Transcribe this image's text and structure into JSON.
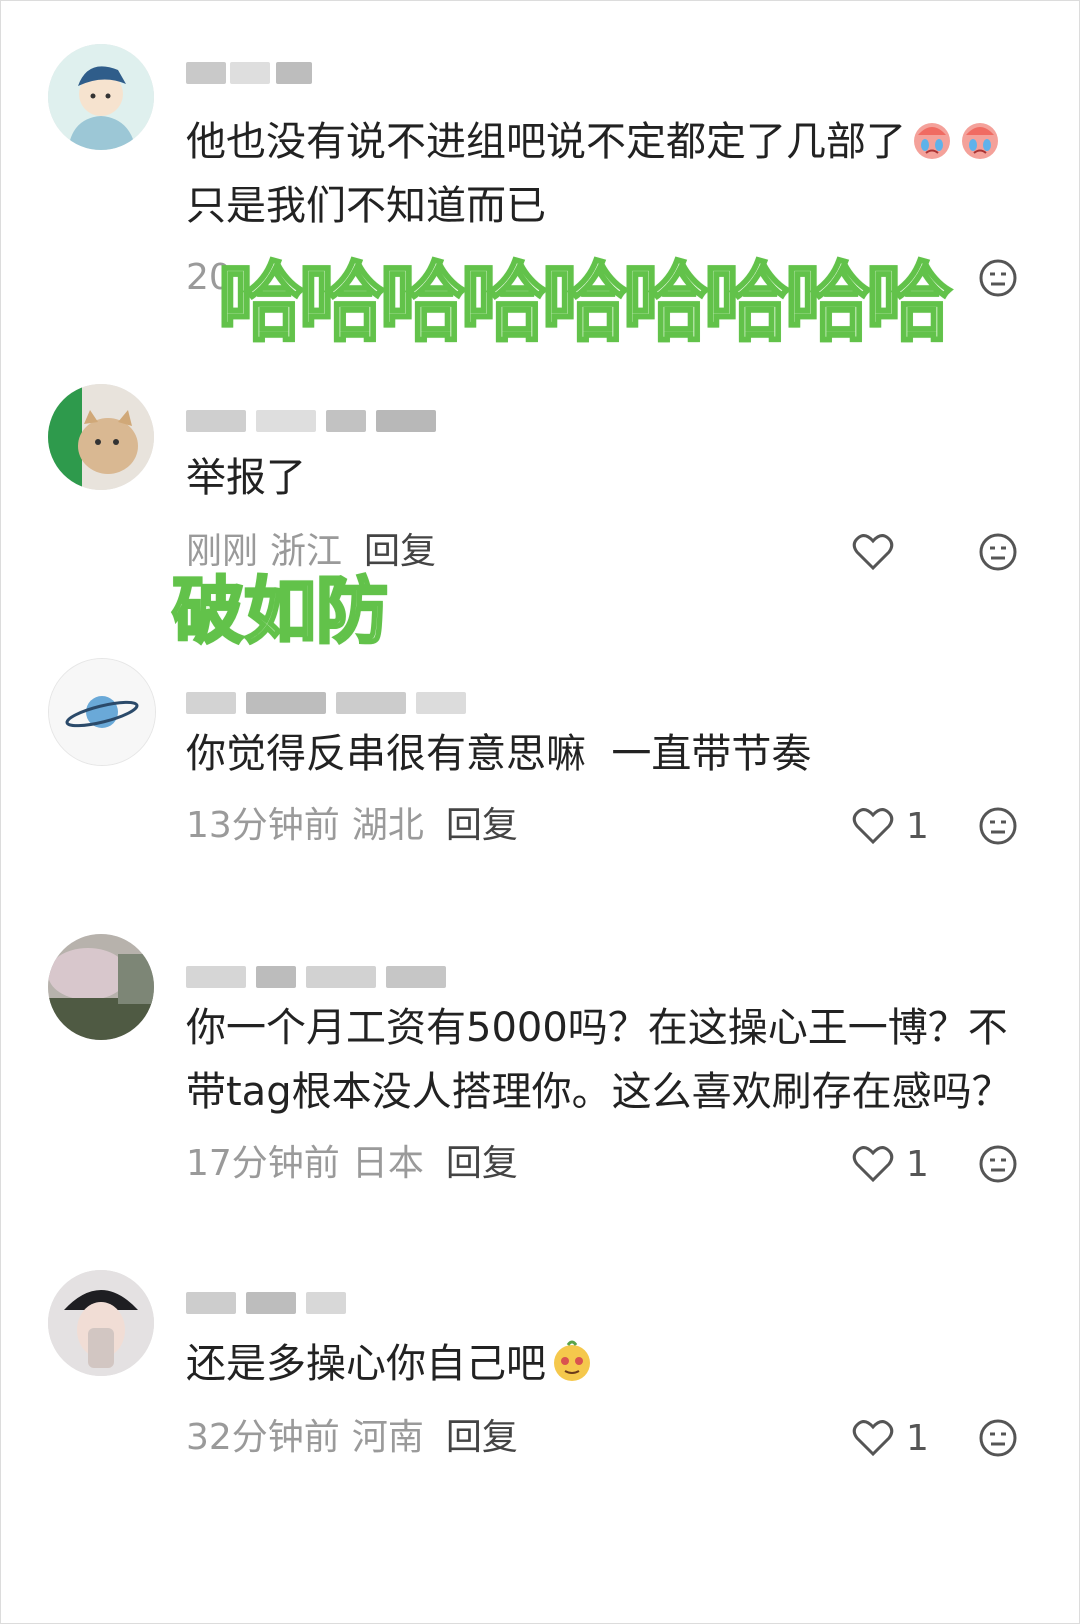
{
  "comments": [
    {
      "text": "他也没有说不进组吧说不定都定了几部了",
      "text2": "只是我们不知道而已",
      "time": "20",
      "location": "",
      "reply": "",
      "likes": ""
    },
    {
      "text": "举报了",
      "time": "刚刚",
      "location": "浙江",
      "reply": "回复",
      "likes": ""
    },
    {
      "text": "你觉得反串很有意思嘛  一直带节奏",
      "time": "13分钟前",
      "location": "湖北",
      "reply": "回复",
      "likes": "1"
    },
    {
      "text": "你一个月工资有5000吗？在这操心王一博？不带tag根本没人搭理你。这么喜欢刷存在感吗？",
      "time": "17分钟前",
      "location": "日本",
      "reply": "回复",
      "likes": "1"
    },
    {
      "text": "还是多操心你自己吧",
      "time": "32分钟前",
      "location": "河南",
      "reply": "回复",
      "likes": "1"
    }
  ],
  "overlays": {
    "laugh": "哈哈哈哈哈哈哈哈哈",
    "broken": "破如防"
  },
  "colors": {
    "overlay_stroke": "#62c24a",
    "overlay_fill": "#e9fbe3",
    "meta_text": "#9a9a9a",
    "body_text": "#222222"
  },
  "icons": [
    "heart-icon",
    "more-icon",
    "crying-emoji-icon",
    "smug-emoji-icon"
  ]
}
